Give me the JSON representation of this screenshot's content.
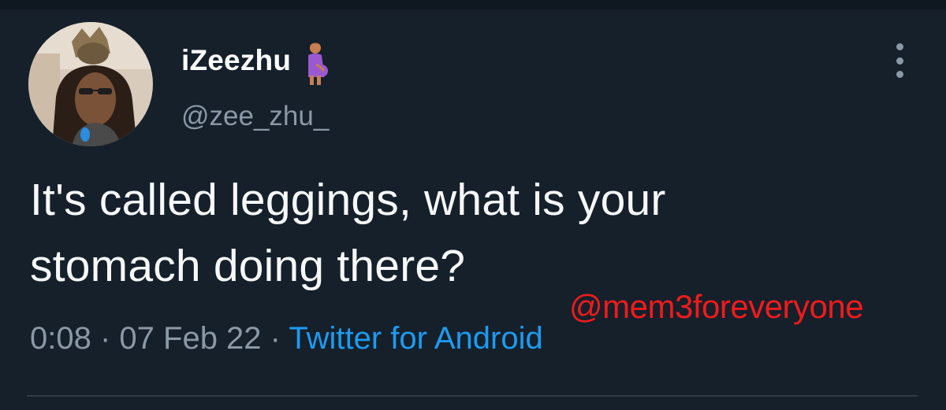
{
  "tweet": {
    "author": {
      "display_name": "iZeezhu",
      "name_emoji": "pregnant-person-emoji",
      "handle": "@zee_zhu_",
      "avatar": "avatar-photo"
    },
    "text_line1": "It's called leggings, what is your",
    "text_line2": "stomach doing there?",
    "time": "0:08",
    "separator1": " · ",
    "date": "07 Feb 22",
    "separator2": " · ",
    "source": "Twitter for Android",
    "more_icon": "more-vertical-icon"
  },
  "watermark": "@mem3foreveryone",
  "colors": {
    "background": "#15202b",
    "text": "#f7f9f9",
    "secondary_text": "#8b98a5",
    "link": "#1d9bf0",
    "watermark": "#ef1b1b"
  }
}
